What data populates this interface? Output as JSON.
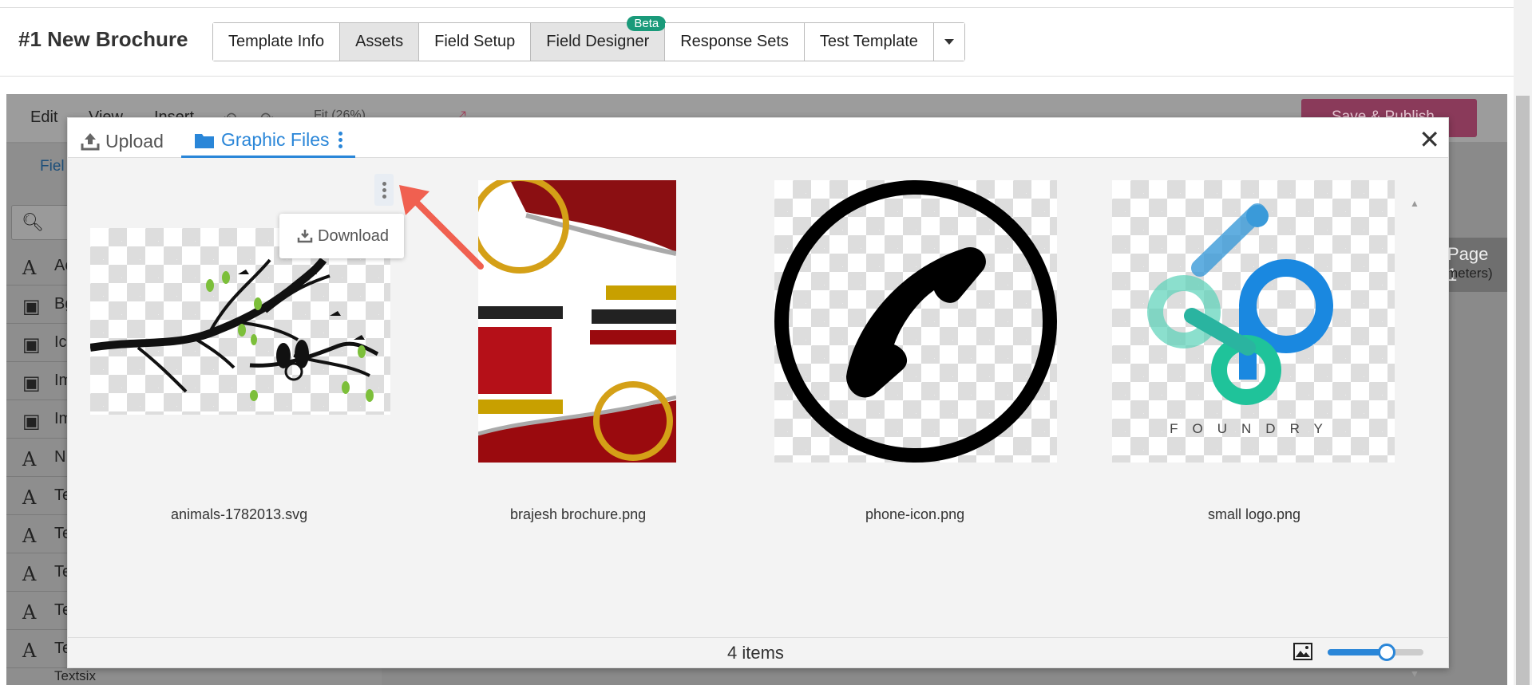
{
  "header": {
    "doc_title": "#1 New Brochure",
    "tabs": [
      {
        "label": "Template Info"
      },
      {
        "label": "Assets"
      },
      {
        "label": "Field Setup"
      },
      {
        "label": "Field Designer",
        "badge": "Beta"
      },
      {
        "label": "Response Sets"
      },
      {
        "label": "Test Template"
      }
    ]
  },
  "editor": {
    "menu": [
      "Edit",
      "View",
      "Insert"
    ],
    "zoom": "Fit (26%)",
    "save_label": "Save & Publish",
    "page_label": "Page 1",
    "left_items": [
      {
        "icon": "A",
        "label": "Ac"
      },
      {
        "icon": "img",
        "label": "Bg"
      },
      {
        "icon": "img",
        "label": "Ic"
      },
      {
        "icon": "img",
        "label": "Im"
      },
      {
        "icon": "img",
        "label": "Im"
      },
      {
        "icon": "A",
        "label": "N"
      },
      {
        "icon": "A",
        "label": "Te"
      },
      {
        "icon": "A",
        "label": "Te"
      },
      {
        "icon": "A",
        "label": "Te"
      },
      {
        "icon": "A",
        "label": "Te"
      },
      {
        "icon": "A",
        "label": "Te"
      }
    ],
    "last_item": "Textsix",
    "field_tab": "Fiel",
    "right_label": "meters)"
  },
  "modal": {
    "tabs": {
      "upload": "Upload",
      "files": "Graphic Files"
    },
    "popover": {
      "download": "Download"
    },
    "files": [
      {
        "name": "animals-1782013.svg"
      },
      {
        "name": "brajesh brochure.png"
      },
      {
        "name": "phone-icon.png"
      },
      {
        "name": "small logo.png"
      }
    ],
    "logo_text": "FOUNDRY",
    "count": "4 items",
    "zoom_level": 0.62
  },
  "colors": {
    "accent": "#2a86d8",
    "beta_badge": "#1a9a7a",
    "save_button": "#8a3a5a",
    "arrow": "#f06050"
  }
}
